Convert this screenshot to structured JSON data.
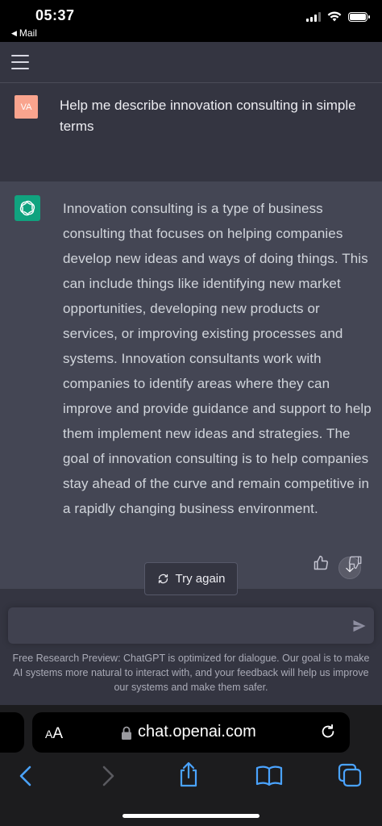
{
  "status_bar": {
    "time": "05:37",
    "back_app": "Mail"
  },
  "colors": {
    "chat_bg": "#343541",
    "assistant_bg": "#444654",
    "user_avatar": "#f9a48e",
    "assistant_avatar": "#10a37f"
  },
  "header": {
    "menu_icon": "hamburger-icon"
  },
  "conversation": {
    "user": {
      "avatar_initials": "VA",
      "message": "Help me describe innovation consulting in simple terms"
    },
    "assistant": {
      "avatar_icon": "openai-logo-icon",
      "message": "Innovation consulting is a type of business consulting that focuses on helping companies develop new ideas and ways of doing things. This can include things like identifying new market opportunities, developing new products or services, or improving existing processes and systems. Innovation consultants work with companies to identify areas where they can improve and provide guidance and support to help them implement new ideas and strategies. The goal of innovation consulting is to help companies stay ahead of the curve and remain competitive in a rapidly changing business environment."
    }
  },
  "actions": {
    "try_again": "Try again"
  },
  "composer": {
    "value": "",
    "send_icon": "send-icon"
  },
  "disclaimer": "Free Research Preview: ChatGPT is optimized for dialogue. Our goal is to make AI systems more natural to interact with, and your feedback will help us improve our systems and make them safer.",
  "browser": {
    "aa_small": "A",
    "aa_large": "A",
    "url": "chat.openai.com"
  }
}
